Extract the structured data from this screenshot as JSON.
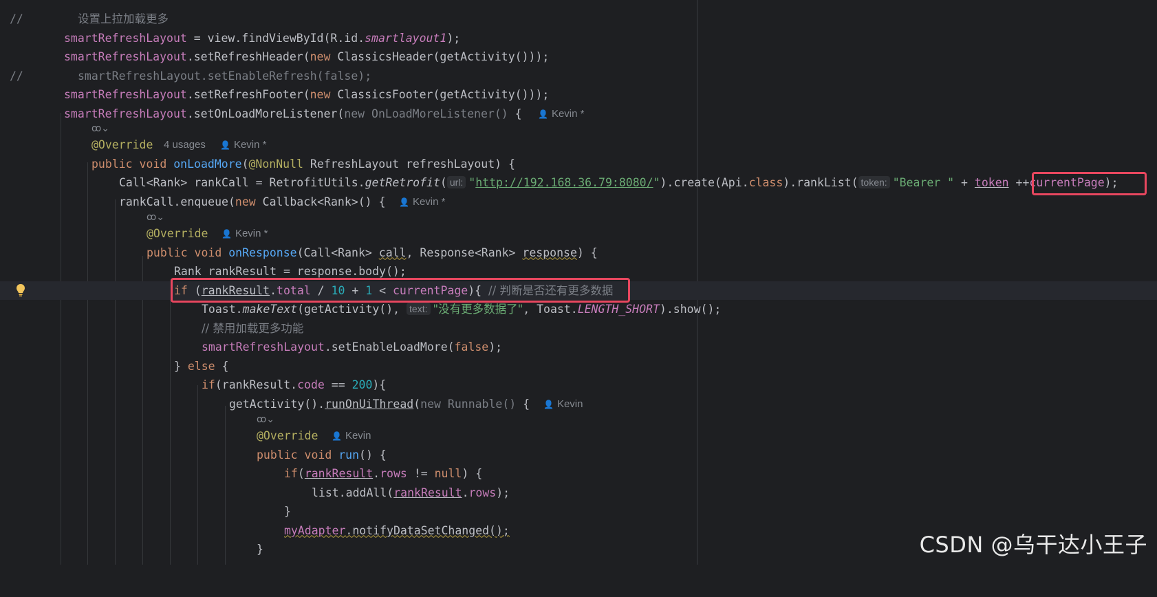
{
  "editor": {
    "lines": {
      "l1": {
        "marker": "//",
        "comment": "设置上拉加载更多"
      },
      "l2": {
        "a": "smartRefreshLayout",
        "b": " = view.findViewById(R.id.",
        "c": "smartlayout1",
        "d": ");"
      },
      "l3": {
        "a": "smartRefreshLayout",
        "b": ".setRefreshHeader(",
        "c": "new",
        "d": " ClassicsHeader(getActivity()));"
      },
      "l4": {
        "marker": "//",
        "comment": "smartRefreshLayout.setEnableRefresh(false);"
      },
      "l5": {
        "a": "smartRefreshLayout",
        "b": ".setRefreshFooter(",
        "c": "new",
        "d": " ClassicsFooter(getActivity()));"
      },
      "l6": {
        "a": "smartRefreshLayout",
        "b": ".setOnLoadMoreListener(",
        "c": "new OnLoadMoreListener()",
        "d": " {",
        "author": "Kevin *"
      },
      "l7": {
        "lambda": "ꝏ⌄"
      },
      "l8": {
        "anno": "@Override",
        "usages": "4 usages",
        "author": "Kevin *"
      },
      "l9": {
        "a": "public void ",
        "b": "onLoadMore",
        "c": "(",
        "d": "@NonNull",
        "e": " RefreshLayout refreshLayout) {"
      },
      "l10": {
        "a": "Call<Rank> rankCall = RetrofitUtils.",
        "b": "getRetrofit",
        "c": "(",
        "hint_url": "url:",
        "d": "\"",
        "e": "http://192.168.36.79:8080/",
        "f": "\"",
        "g": ").create(Api.",
        "h": "class",
        "i": ").rankList(",
        "hint_token": "token:",
        "j": "\"Bearer \"",
        "k": " + ",
        "l": "token",
        "m": " ++",
        "n": "currentPage",
        "o": ");"
      },
      "l11": {
        "a": "rankCall.enqueue(",
        "b": "new",
        "c": " Callback<Rank>() {",
        "author": "Kevin *"
      },
      "l12": {
        "lambda": "ꝏ⌄"
      },
      "l13": {
        "anno": "@Override",
        "author": "Kevin *"
      },
      "l14": {
        "a": "public void ",
        "b": "onResponse",
        "c": "(Call<Rank> ",
        "d": "call",
        "e": ", Response<Rank> ",
        "f": "response",
        "g": ") {"
      },
      "l15": {
        "a": "Rank rankResult = response.body();"
      },
      "l16": {
        "a": "if",
        "b": " (",
        "c": "rankResult",
        "d": ".",
        "e": "total",
        "f": " / ",
        "g": "10",
        "h": " + ",
        "i": "1",
        "j": " < ",
        "k": "currentPage",
        "l": "){ ",
        "m": "// 判断是否还有更多数据"
      },
      "l17": {
        "a": "Toast.",
        "b": "makeText",
        "c": "(getActivity(), ",
        "hint_text": "text:",
        "d": "\"没有更多数据了\"",
        "e": ", Toast.",
        "f": "LENGTH_SHORT",
        "g": ").show();"
      },
      "l18": {
        "a": "// 禁用加载更多功能"
      },
      "l19": {
        "a": "smartRefreshLayout",
        "b": ".setEnableLoadMore(",
        "c": "false",
        "d": ");"
      },
      "l20": {
        "a": "} ",
        "b": "else",
        "c": " {"
      },
      "l21": {
        "a": "if",
        "b": "(rankResult.",
        "c": "code",
        "d": " == ",
        "e": "200",
        "f": "){"
      },
      "l22": {
        "a": "getActivity().",
        "b": "runOnUiThread",
        "c": "(",
        "d": "new Runnable()",
        "e": " {",
        "author": "Kevin"
      },
      "l23": {
        "lambda": "ꝏ⌄"
      },
      "l24": {
        "anno": "@Override",
        "author": "Kevin"
      },
      "l25": {
        "a": "public void ",
        "b": "run",
        "c": "() {"
      },
      "l26": {
        "a": "if",
        "b": "(",
        "c": "rankResult",
        "d": ".",
        "e": "rows",
        "f": " != ",
        "g": "null",
        "h": ") {"
      },
      "l27": {
        "a": "list.addAll(",
        "b": "rankResult",
        "c": ".",
        "d": "rows",
        "e": ");"
      },
      "l28": {
        "a": "}"
      },
      "l29": {
        "a": "myAdapter",
        "b": ".notifyDataSetChanged();"
      },
      "l30": {
        "a": "}"
      }
    }
  },
  "watermark": "CSDN @乌干达小王子",
  "icons": {
    "intention": "lightbulb-icon",
    "lambda": "lambda-gutter-icon",
    "author": "user-icon"
  },
  "colors": {
    "background": "#1e1f22",
    "highlight_box": "#e8475f",
    "field": "#c77dbb",
    "keyword": "#cf8e6d",
    "string": "#6aab73",
    "function": "#56a8f5",
    "annotation": "#b3ae60"
  }
}
